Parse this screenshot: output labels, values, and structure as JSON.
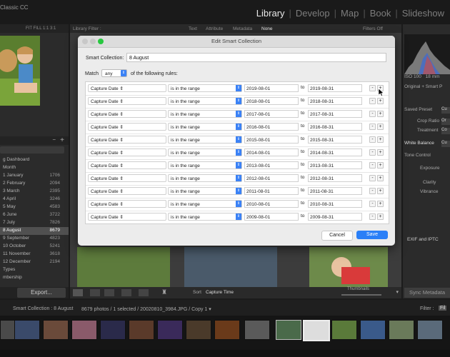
{
  "app": {
    "title": "Classic CC"
  },
  "modules": [
    "Library",
    "Develop",
    "Map",
    "Book",
    "Slideshow"
  ],
  "active_module": "Library",
  "left_panel": {
    "tree_items": [
      {
        "label": "g Dashboard",
        "count": ""
      },
      {
        "label": "Month",
        "count": ""
      },
      {
        "label": "1 January",
        "count": "1706"
      },
      {
        "label": "2 February",
        "count": "2094"
      },
      {
        "label": "3 March",
        "count": "2395"
      },
      {
        "label": "4 April",
        "count": "3246"
      },
      {
        "label": "5 May",
        "count": "4583"
      },
      {
        "label": "6 June",
        "count": "3722"
      },
      {
        "label": "7 July",
        "count": "7826"
      },
      {
        "label": "8 August",
        "count": "8679"
      },
      {
        "label": "9 September",
        "count": "4823"
      },
      {
        "label": "10 October",
        "count": "5241"
      },
      {
        "label": "11 November",
        "count": "3618"
      },
      {
        "label": "12 December",
        "count": "2194"
      },
      {
        "label": "Types",
        "count": ""
      },
      {
        "label": "mbership",
        "count": ""
      }
    ],
    "selected_index": 9,
    "export_label": "Export..."
  },
  "filter_bar": {
    "label": "Library Filter :",
    "options": [
      "Text",
      "Attribute",
      "Metadata",
      "None"
    ],
    "right": "Filters Off"
  },
  "toolbar": {
    "sort_label": "Sort",
    "sort_value": "Capture Time",
    "thumbnails_label": "Thumbnails"
  },
  "right_panel": {
    "iso": "ISO 100",
    "focal": "18 mm",
    "original": "Original + Smart P",
    "saved_preset": "Saved Preset",
    "saved_preset_btn": "Cu",
    "crop_ratio": "Crop Ratio",
    "crop_btn": "Or",
    "treatment": "Treatment",
    "treatment_btn": "Co",
    "white_balance": "White Balance",
    "wb_btn": "Cu",
    "tone_control": "Tone Control",
    "exposure": "Exposure",
    "clarity": "Clarity",
    "vibrance": "Vibrance",
    "exif_label": "EXIF and IPTC",
    "sync_label": "Sync Metadata"
  },
  "filmstrip_bar": {
    "collection": "Smart Collection : 8 August",
    "info": "8679 photos / 1 selected / 20020810_3984.JPG / Copy 1 ▾",
    "filter_label": "Filter :",
    "filter_value": "Fil"
  },
  "dialog": {
    "title": "Edit Smart Collection",
    "smart_collection_label": "Smart Collection:",
    "smart_collection_value": "8 August",
    "match_label": "Match",
    "match_value": "any",
    "match_tail": "of the following rules:",
    "rules": [
      {
        "field": "Capture Date",
        "op": "is in the range",
        "from": "2019-08-01",
        "to": "2019-08-31"
      },
      {
        "field": "Capture Date",
        "op": "is in the range",
        "from": "2018-08-01",
        "to": "2018-08-31"
      },
      {
        "field": "Capture Date",
        "op": "is in the range",
        "from": "2017-08-01",
        "to": "2017-08-31"
      },
      {
        "field": "Capture Date",
        "op": "is in the range",
        "from": "2016-08-01",
        "to": "2016-08-31"
      },
      {
        "field": "Capture Date",
        "op": "is in the range",
        "from": "2015-08-01",
        "to": "2015-08-31"
      },
      {
        "field": "Capture Date",
        "op": "is in the range",
        "from": "2014-08-01",
        "to": "2014-08-31"
      },
      {
        "field": "Capture Date",
        "op": "is in the range",
        "from": "2013-08-01",
        "to": "2013-08-31"
      },
      {
        "field": "Capture Date",
        "op": "is in the range",
        "from": "2012-08-01",
        "to": "2012-08-31"
      },
      {
        "field": "Capture Date",
        "op": "is in the range",
        "from": "2011-08-01",
        "to": "2011-08-31"
      },
      {
        "field": "Capture Date",
        "op": "is in the range",
        "from": "2010-08-01",
        "to": "2010-08-31"
      },
      {
        "field": "Capture Date",
        "op": "is in the range",
        "from": "2009-08-01",
        "to": "2009-08-31"
      }
    ],
    "to_label": "to",
    "minus": "-",
    "plus": "+",
    "cancel_label": "Cancel",
    "save_label": "Save"
  },
  "colors": {
    "accent": "#2a7ff7",
    "select_cap": "#3b82f6",
    "selected_row": "#505050"
  }
}
